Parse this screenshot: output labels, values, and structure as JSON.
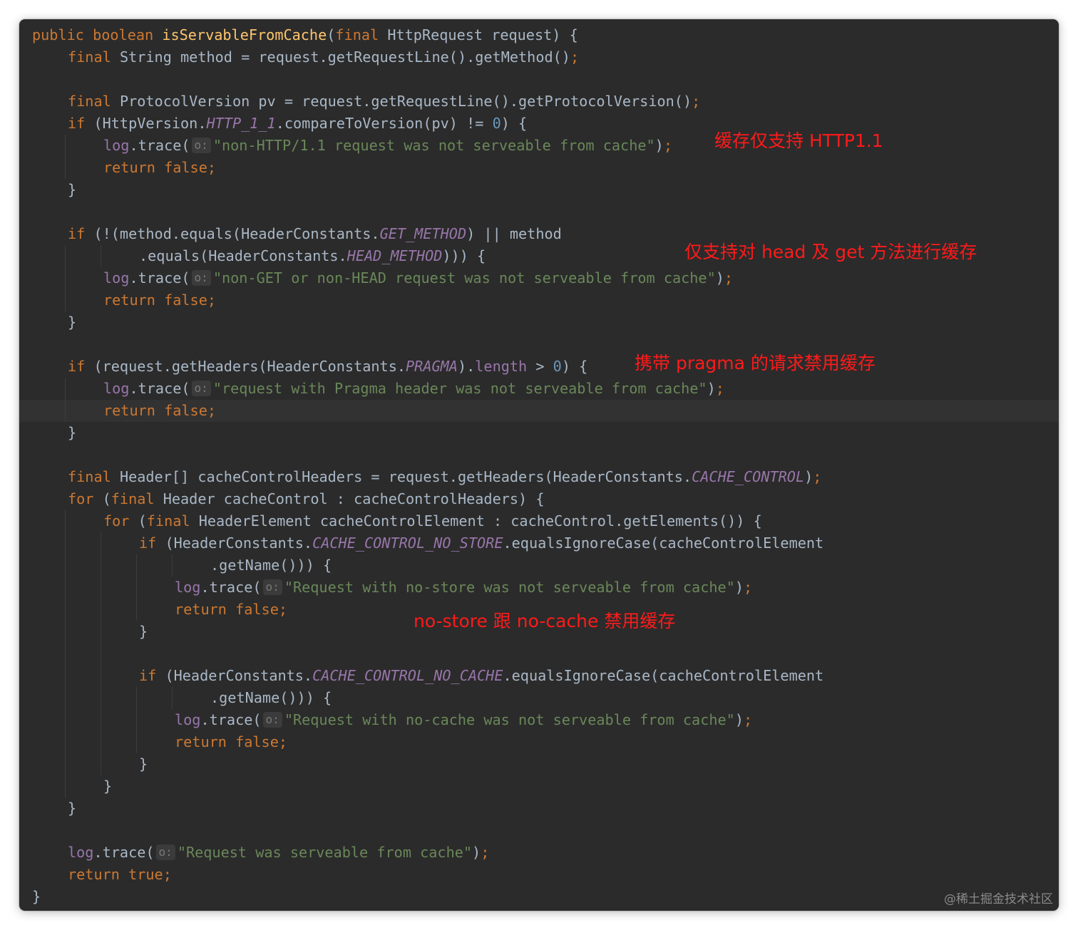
{
  "code": {
    "lines": [
      {
        "indent": 0,
        "tokens": [
          {
            "t": "public boolean ",
            "c": "kw"
          },
          {
            "t": "isServableFromCache",
            "c": "fn"
          },
          {
            "t": "(",
            "c": ""
          },
          {
            "t": "final ",
            "c": "kw"
          },
          {
            "t": "HttpRequest request) {",
            "c": ""
          }
        ]
      },
      {
        "indent": 1,
        "tokens": [
          {
            "t": "final ",
            "c": "kw"
          },
          {
            "t": "String method = request.getRequestLine().getMethod()",
            "c": ""
          },
          {
            "t": ";",
            "c": "kw"
          }
        ]
      },
      {
        "indent": 0,
        "tokens": []
      },
      {
        "indent": 1,
        "tokens": [
          {
            "t": "final ",
            "c": "kw"
          },
          {
            "t": "ProtocolVersion pv = request.getRequestLine().getProtocolVersion()",
            "c": ""
          },
          {
            "t": ";",
            "c": "kw"
          }
        ]
      },
      {
        "indent": 1,
        "tokens": [
          {
            "t": "if ",
            "c": "kw"
          },
          {
            "t": "(HttpVersion.",
            "c": ""
          },
          {
            "t": "HTTP_1_1",
            "c": "const"
          },
          {
            "t": ".compareToVersion(pv) != ",
            "c": ""
          },
          {
            "t": "0",
            "c": "num"
          },
          {
            "t": ") {",
            "c": ""
          }
        ]
      },
      {
        "indent": 2,
        "tokens": [
          {
            "t": "log",
            "c": "field"
          },
          {
            "t": ".trace(",
            "c": ""
          },
          {
            "t": "o:",
            "c": "hint"
          },
          {
            "t": "\"non-HTTP/1.1 request was not serveable from cache\"",
            "c": "str"
          },
          {
            "t": ")",
            "c": ""
          },
          {
            "t": ";",
            "c": "kw"
          }
        ]
      },
      {
        "indent": 2,
        "tokens": [
          {
            "t": "return false;",
            "c": "kw"
          }
        ]
      },
      {
        "indent": 1,
        "tokens": [
          {
            "t": "}",
            "c": ""
          }
        ]
      },
      {
        "indent": 0,
        "tokens": []
      },
      {
        "indent": 1,
        "tokens": [
          {
            "t": "if ",
            "c": "kw"
          },
          {
            "t": "(!(method.equals(HeaderConstants.",
            "c": ""
          },
          {
            "t": "GET_METHOD",
            "c": "const"
          },
          {
            "t": ") || method",
            "c": ""
          }
        ]
      },
      {
        "indent": 3,
        "tokens": [
          {
            "t": ".equals(HeaderConstants.",
            "c": ""
          },
          {
            "t": "HEAD_METHOD",
            "c": "const"
          },
          {
            "t": "))) {",
            "c": ""
          }
        ]
      },
      {
        "indent": 2,
        "tokens": [
          {
            "t": "log",
            "c": "field"
          },
          {
            "t": ".trace(",
            "c": ""
          },
          {
            "t": "o:",
            "c": "hint"
          },
          {
            "t": "\"non-GET or non-HEAD request was not serveable from cache\"",
            "c": "str"
          },
          {
            "t": ")",
            "c": ""
          },
          {
            "t": ";",
            "c": "kw"
          }
        ]
      },
      {
        "indent": 2,
        "tokens": [
          {
            "t": "return false;",
            "c": "kw"
          }
        ]
      },
      {
        "indent": 1,
        "tokens": [
          {
            "t": "}",
            "c": ""
          }
        ]
      },
      {
        "indent": 0,
        "tokens": []
      },
      {
        "indent": 1,
        "tokens": [
          {
            "t": "if ",
            "c": "kw"
          },
          {
            "t": "(request.getHeaders(HeaderConstants.",
            "c": ""
          },
          {
            "t": "PRAGMA",
            "c": "const"
          },
          {
            "t": ").",
            "c": ""
          },
          {
            "t": "length",
            "c": "field"
          },
          {
            "t": " > ",
            "c": ""
          },
          {
            "t": "0",
            "c": "num"
          },
          {
            "t": ") {",
            "c": ""
          }
        ]
      },
      {
        "indent": 2,
        "tokens": [
          {
            "t": "log",
            "c": "field"
          },
          {
            "t": ".trace(",
            "c": ""
          },
          {
            "t": "o:",
            "c": "hint"
          },
          {
            "t": "\"request with Pragma header was not serveable from cache\"",
            "c": "str"
          },
          {
            "t": ")",
            "c": ""
          },
          {
            "t": ";",
            "c": "kw"
          }
        ]
      },
      {
        "indent": 2,
        "tokens": [
          {
            "t": "return false;",
            "c": "kw"
          }
        ]
      },
      {
        "indent": 1,
        "tokens": [
          {
            "t": "}",
            "c": ""
          }
        ]
      },
      {
        "indent": 0,
        "tokens": []
      },
      {
        "indent": 1,
        "tokens": [
          {
            "t": "final ",
            "c": "kw"
          },
          {
            "t": "Header[] cacheControlHeaders = request.getHeaders(HeaderConstants.",
            "c": ""
          },
          {
            "t": "CACHE_CONTROL",
            "c": "const"
          },
          {
            "t": ")",
            "c": ""
          },
          {
            "t": ";",
            "c": "kw"
          }
        ]
      },
      {
        "indent": 1,
        "tokens": [
          {
            "t": "for ",
            "c": "kw"
          },
          {
            "t": "(",
            "c": ""
          },
          {
            "t": "final ",
            "c": "kw"
          },
          {
            "t": "Header cacheControl : cacheControlHeaders) {",
            "c": ""
          }
        ]
      },
      {
        "indent": 2,
        "tokens": [
          {
            "t": "for ",
            "c": "kw"
          },
          {
            "t": "(",
            "c": ""
          },
          {
            "t": "final ",
            "c": "kw"
          },
          {
            "t": "HeaderElement cacheControlElement : cacheControl.getElements()) {",
            "c": ""
          }
        ]
      },
      {
        "indent": 3,
        "tokens": [
          {
            "t": "if ",
            "c": "kw"
          },
          {
            "t": "(HeaderConstants.",
            "c": ""
          },
          {
            "t": "CACHE_CONTROL_NO_STORE",
            "c": "const"
          },
          {
            "t": ".equalsIgnoreCase(cacheControlElement",
            "c": ""
          }
        ]
      },
      {
        "indent": 5,
        "tokens": [
          {
            "t": ".getName())) {",
            "c": ""
          }
        ]
      },
      {
        "indent": 4,
        "tokens": [
          {
            "t": "log",
            "c": "field"
          },
          {
            "t": ".trace(",
            "c": ""
          },
          {
            "t": "o:",
            "c": "hint"
          },
          {
            "t": "\"Request with no-store was not serveable from cache\"",
            "c": "str"
          },
          {
            "t": ")",
            "c": ""
          },
          {
            "t": ";",
            "c": "kw"
          }
        ]
      },
      {
        "indent": 4,
        "tokens": [
          {
            "t": "return false;",
            "c": "kw"
          }
        ]
      },
      {
        "indent": 3,
        "tokens": [
          {
            "t": "}",
            "c": ""
          }
        ]
      },
      {
        "indent": 0,
        "tokens": []
      },
      {
        "indent": 3,
        "tokens": [
          {
            "t": "if ",
            "c": "kw"
          },
          {
            "t": "(HeaderConstants.",
            "c": ""
          },
          {
            "t": "CACHE_CONTROL_NO_CACHE",
            "c": "const"
          },
          {
            "t": ".equalsIgnoreCase(cacheControlElement",
            "c": ""
          }
        ]
      },
      {
        "indent": 5,
        "tokens": [
          {
            "t": ".getName())) {",
            "c": ""
          }
        ]
      },
      {
        "indent": 4,
        "tokens": [
          {
            "t": "log",
            "c": "field"
          },
          {
            "t": ".trace(",
            "c": ""
          },
          {
            "t": "o:",
            "c": "hint"
          },
          {
            "t": "\"Request with no-cache was not serveable from cache\"",
            "c": "str"
          },
          {
            "t": ")",
            "c": ""
          },
          {
            "t": ";",
            "c": "kw"
          }
        ]
      },
      {
        "indent": 4,
        "tokens": [
          {
            "t": "return false;",
            "c": "kw"
          }
        ]
      },
      {
        "indent": 3,
        "tokens": [
          {
            "t": "}",
            "c": ""
          }
        ]
      },
      {
        "indent": 2,
        "tokens": [
          {
            "t": "}",
            "c": ""
          }
        ]
      },
      {
        "indent": 1,
        "tokens": [
          {
            "t": "}",
            "c": ""
          }
        ]
      },
      {
        "indent": 0,
        "tokens": []
      },
      {
        "indent": 1,
        "tokens": [
          {
            "t": "log",
            "c": "field"
          },
          {
            "t": ".trace(",
            "c": ""
          },
          {
            "t": "o:",
            "c": "hint"
          },
          {
            "t": "\"Request was serveable from cache\"",
            "c": "str"
          },
          {
            "t": ")",
            "c": ""
          },
          {
            "t": ";",
            "c": "kw"
          }
        ]
      },
      {
        "indent": 1,
        "tokens": [
          {
            "t": "return true;",
            "c": "kw"
          }
        ]
      },
      {
        "indent": 0,
        "tokens": [
          {
            "t": "}",
            "c": ""
          }
        ]
      }
    ]
  },
  "annotations": {
    "http11": "缓存仅支持 HTTP1.1",
    "head_get": "仅支持对 head 及 get 方法进行缓存",
    "pragma": "携带 pragma 的请求禁用缓存",
    "no_store_no_cache": "no-store 跟 no-cache 禁用缓存"
  },
  "watermark": "@稀土掘金技术社区",
  "colors": {
    "editor_background": "#2b2b2b",
    "keyword": "#cc7832",
    "function_name": "#ffc66d",
    "string": "#6a8759",
    "number": "#6897bb",
    "constant": "#9876aa",
    "default_text": "#a9b7c6",
    "annotation": "#ff1a1a"
  }
}
